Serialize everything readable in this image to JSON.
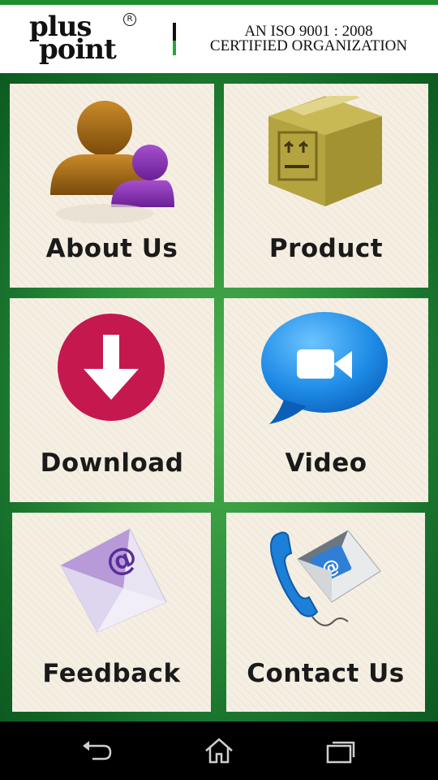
{
  "header": {
    "logo_line1": "plus",
    "logo_line2": "point",
    "logo_reg": "R",
    "iso_line1": "AN ISO 9001 : 2008",
    "iso_line2": "CERTIFIED ORGANIZATION"
  },
  "tiles": [
    {
      "label": "About Us",
      "icon": "users-icon"
    },
    {
      "label": "Product",
      "icon": "box-icon"
    },
    {
      "label": "Download",
      "icon": "download-icon"
    },
    {
      "label": "Video",
      "icon": "video-chat-icon"
    },
    {
      "label": "Feedback",
      "icon": "envelope-at-icon"
    },
    {
      "label": "Contact Us",
      "icon": "phone-mail-icon"
    }
  ],
  "navbar": {
    "back": "back-icon",
    "home": "home-icon",
    "recents": "recents-icon"
  },
  "colors": {
    "accent_green": "#1f8f2a",
    "tile_bg": "#f5efe4",
    "download_red": "#c4184f",
    "video_blue": "#1e8be6",
    "box_gold": "#b9a84a"
  }
}
